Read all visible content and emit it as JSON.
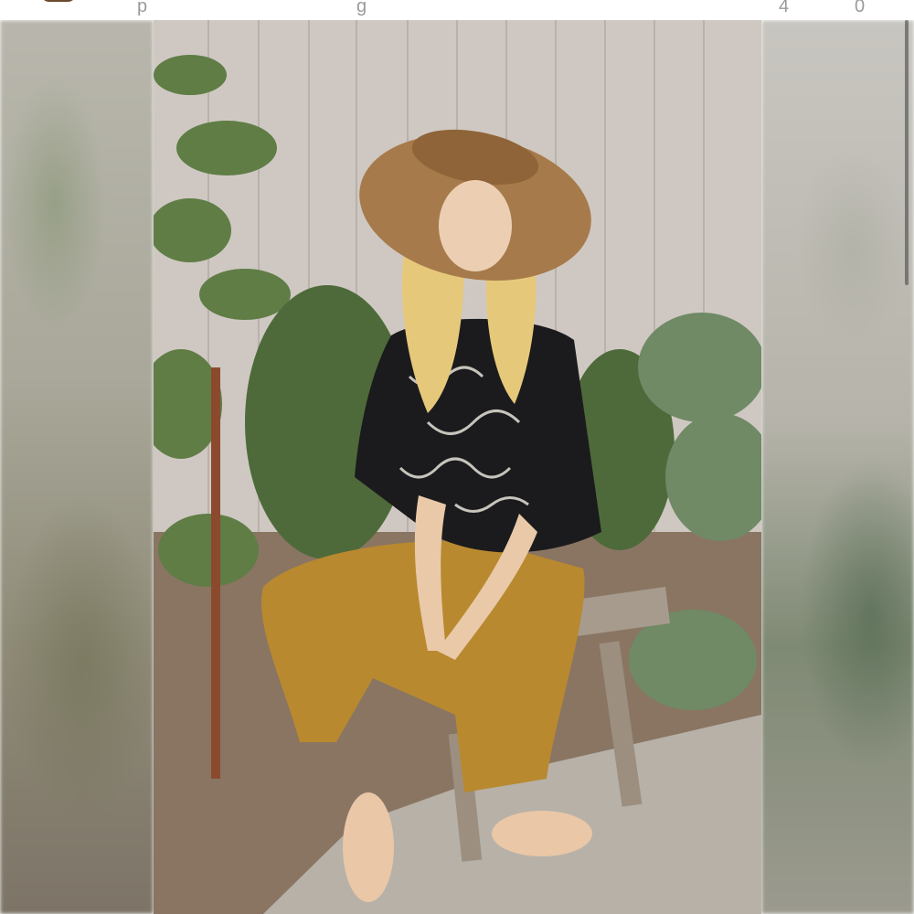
{
  "top_bar": {
    "clipped_text_left": "p",
    "clipped_text_mid": "g",
    "clipped_count_a": "4",
    "clipped_count_b": "0"
  },
  "image": {
    "subject": "photo-of-person-in-hat-seated-on-stool",
    "colors": {
      "hat": "#a67a4a",
      "top": "#1b1b1d",
      "pants": "#b8892f",
      "fence": "#cfc8c2",
      "foliage": "#4e6a3a",
      "ground": "#a99c8c"
    }
  }
}
